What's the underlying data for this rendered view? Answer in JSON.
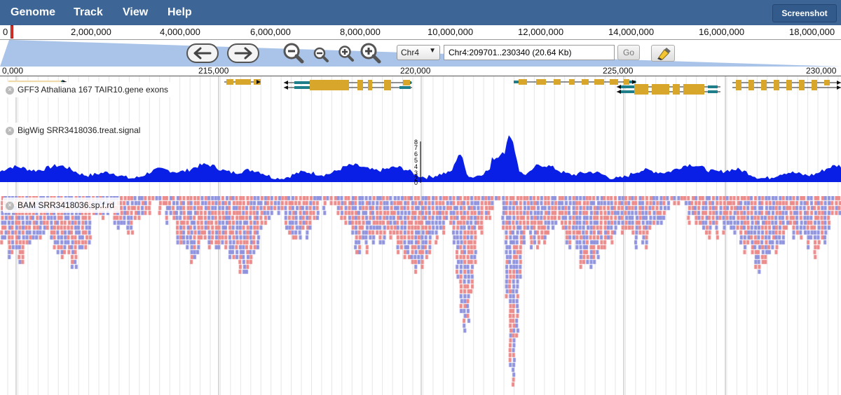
{
  "menu": {
    "items": [
      "Genome",
      "Track",
      "View",
      "Help"
    ],
    "screenshot_label": "Screenshot"
  },
  "overview": {
    "start_label": "0",
    "labels": [
      "2,000,000",
      "4,000,000",
      "6,000,000",
      "8,000,000",
      "10,000,000",
      "12,000,000",
      "14,000,000",
      "16,000,000",
      "18,000,000"
    ]
  },
  "navigation": {
    "chromosome": "Chr4",
    "location": "Chr4:209701..230340 (20.64 Kb)",
    "go_label": "Go",
    "icons": [
      "pan-left-icon",
      "pan-right-icon",
      "zoom-out-big-icon",
      "zoom-out-icon",
      "zoom-in-icon",
      "zoom-in-big-icon",
      "highlight-icon"
    ]
  },
  "ruler": {
    "labels": [
      "0,000",
      "215,000",
      "220,000",
      "225,000",
      "230,000"
    ]
  },
  "tracks": {
    "gff": {
      "label": "GFF3 Athaliana 167 TAIR10.gene exons"
    },
    "bigwig": {
      "label": "BigWig SRR3418036.treat.signal",
      "scale_ticks": [
        "8",
        "7",
        "6",
        "5",
        "4",
        "3",
        "2",
        "1"
      ],
      "scale_zero": "0"
    },
    "bam": {
      "label": "BAM SRR3418036.sp.f.rd"
    }
  },
  "colors": {
    "menubar": "#3d6596",
    "signal": "#0a1fe6",
    "read_forward": "#ec8a8a",
    "read_reverse": "#8f93dd",
    "exon": "#d8a62b",
    "utr": "#1e7f8a"
  }
}
